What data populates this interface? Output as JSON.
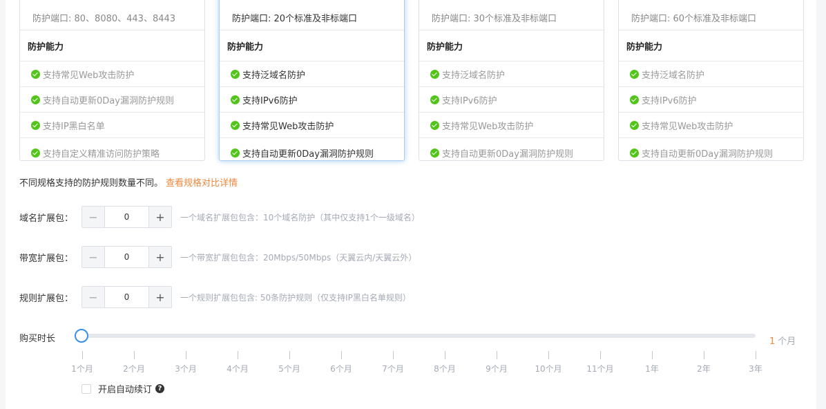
{
  "cards": [
    {
      "port": "防护端口: 80、8080、443、8443",
      "ability_title": "防护能力",
      "features": [
        "支持常见Web攻击防护",
        "支持自动更新0Day漏洞防护规则",
        "支持IP黑白名单",
        "支持自定义精准访问防护策略"
      ]
    },
    {
      "port": "防护端口: 20个标准及非标端口",
      "ability_title": "防护能力",
      "features": [
        "支持泛域名防护",
        "支持IPv6防护",
        "支持常见Web攻击防护",
        "支持自动更新0Day漏洞防护规则"
      ]
    },
    {
      "port": "防护端口: 30个标准及非标端口",
      "ability_title": "防护能力",
      "features": [
        "支持泛域名防护",
        "支持IPv6防护",
        "支持常见Web攻击防护",
        "支持自动更新0Day漏洞防护规则"
      ]
    },
    {
      "port": "防护端口: 60个标准及非标端口",
      "ability_title": "防护能力",
      "features": [
        "支持泛域名防护",
        "支持IPv6防护",
        "支持常见Web攻击防护",
        "支持自动更新0Day漏洞防护规则"
      ]
    }
  ],
  "note": {
    "text": "不同规格支持的防护规则数量不同。",
    "link": "查看规格对比详情"
  },
  "packs": [
    {
      "label": "域名扩展包：",
      "value": "0",
      "hint": "一个域名扩展包包含：10个域名防护（其中仅支持1个一级域名）"
    },
    {
      "label": "带宽扩展包：",
      "value": "0",
      "hint": "一个带宽扩展包包含：20Mbps/50Mbps（天翼云内/天翼云外）"
    },
    {
      "label": "规则扩展包：",
      "value": "0",
      "hint": "一个规则扩展包包含: 50条防护规则（仅支持IP黑白名单规则）"
    }
  ],
  "stepper_icons": {
    "minus": "minus-icon",
    "plus": "plus-icon"
  },
  "duration": {
    "label": "购买时长",
    "value_num": "1",
    "value_unit": "个月",
    "position": 0,
    "ticks": [
      "1个月",
      "2个月",
      "3个月",
      "4个月",
      "5个月",
      "6个月",
      "7个月",
      "8个月",
      "9个月",
      "10个月",
      "11个月",
      "1年",
      "2年",
      "3年"
    ]
  },
  "auto_renew": {
    "label": "开启自动续订",
    "checked": false,
    "help_icon": "question-icon"
  },
  "colors": {
    "accent": "#3a8ee6",
    "link": "#f0883b",
    "check": "#52c41a",
    "hint": "#a4aab5"
  }
}
